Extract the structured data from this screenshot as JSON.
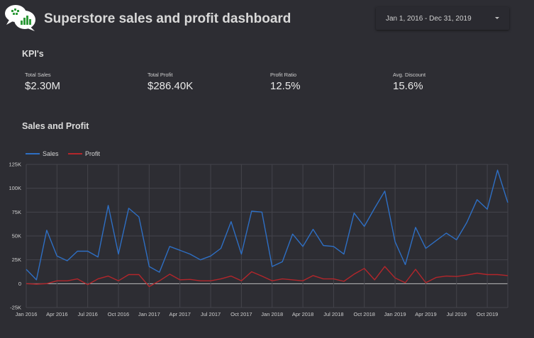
{
  "header": {
    "title": "Superstore sales and profit dashboard",
    "date_range": "Jan 1, 2016 - Dec 31, 2019",
    "logo_icon": "chat-bubbles-chart-icon"
  },
  "kpis": {
    "section_title": "KPI's",
    "items": [
      {
        "label": "Total Sales",
        "value": "$2.30M"
      },
      {
        "label": "Total Profit",
        "value": "$286.40K"
      },
      {
        "label": "Profit Ratio",
        "value": "12.5%"
      },
      {
        "label": "Avg. Discount",
        "value": "15.6%"
      }
    ]
  },
  "sales_profit": {
    "section_title": "Sales and Profit"
  },
  "colors": {
    "background": "#2d2d33",
    "sales": "#2e6fc4",
    "profit": "#b3262b",
    "grid": "#44444b",
    "zero_line": "#bdbdbd"
  },
  "chart_data": {
    "type": "line",
    "x": [
      "Jan 2016",
      "Feb 2016",
      "Mar 2016",
      "Apr 2016",
      "May 2016",
      "Jun 2016",
      "Jul 2016",
      "Aug 2016",
      "Sep 2016",
      "Oct 2016",
      "Nov 2016",
      "Dec 2016",
      "Jan 2017",
      "Feb 2017",
      "Mar 2017",
      "Apr 2017",
      "May 2017",
      "Jun 2017",
      "Jul 2017",
      "Aug 2017",
      "Sep 2017",
      "Oct 2017",
      "Nov 2017",
      "Dec 2017",
      "Jan 2018",
      "Feb 2018",
      "Mar 2018",
      "Apr 2018",
      "May 2018",
      "Jun 2018",
      "Jul 2018",
      "Aug 2018",
      "Sep 2018",
      "Oct 2018",
      "Nov 2018",
      "Dec 2018",
      "Jan 2019",
      "Feb 2019",
      "Mar 2019",
      "Apr 2019",
      "May 2019",
      "Jun 2019",
      "Jul 2019",
      "Aug 2019",
      "Sep 2019",
      "Oct 2019",
      "Nov 2019",
      "Dec 2019"
    ],
    "x_tick_labels": [
      "Jan 2016",
      "Apr 2016",
      "Jul 2016",
      "Oct 2016",
      "Jan 2017",
      "Apr 2017",
      "Jul 2017",
      "Oct 2017",
      "Jan 2018",
      "Apr 2018",
      "Jul 2018",
      "Oct 2018",
      "Jan 2019",
      "Apr 2019",
      "Jul 2019",
      "Oct 2019"
    ],
    "series": [
      {
        "name": "Sales",
        "values": [
          15000,
          4000,
          56000,
          29000,
          24000,
          34000,
          34000,
          28000,
          82000,
          31000,
          79000,
          70000,
          18000,
          12000,
          39000,
          35000,
          31000,
          25000,
          29000,
          37000,
          65000,
          31000,
          76000,
          75000,
          18000,
          23000,
          52000,
          39000,
          57000,
          40000,
          39000,
          31000,
          74000,
          60000,
          79000,
          97000,
          44000,
          20000,
          59000,
          37000,
          45000,
          53000,
          46000,
          64000,
          88000,
          78000,
          119000,
          85000
        ]
      },
      {
        "name": "Profit",
        "values": [
          0,
          -500,
          0,
          3000,
          3000,
          5000,
          -1000,
          5000,
          8000,
          3000,
          9500,
          9500,
          -3000,
          3000,
          10000,
          4000,
          4500,
          3000,
          3000,
          5000,
          8000,
          3000,
          12500,
          8000,
          3000,
          5000,
          4000,
          3000,
          8500,
          5000,
          5000,
          2500,
          10000,
          16000,
          4000,
          18000,
          6000,
          1000,
          15000,
          1000,
          6500,
          8000,
          7500,
          9000,
          11000,
          9500,
          9500,
          8500
        ]
      }
    ],
    "y_ticks": [
      "125K",
      "100K",
      "75K",
      "50K",
      "25K",
      "0",
      "-25K"
    ],
    "ylim": [
      -25000,
      125000
    ],
    "legend_position": "top-left",
    "grid": true
  }
}
